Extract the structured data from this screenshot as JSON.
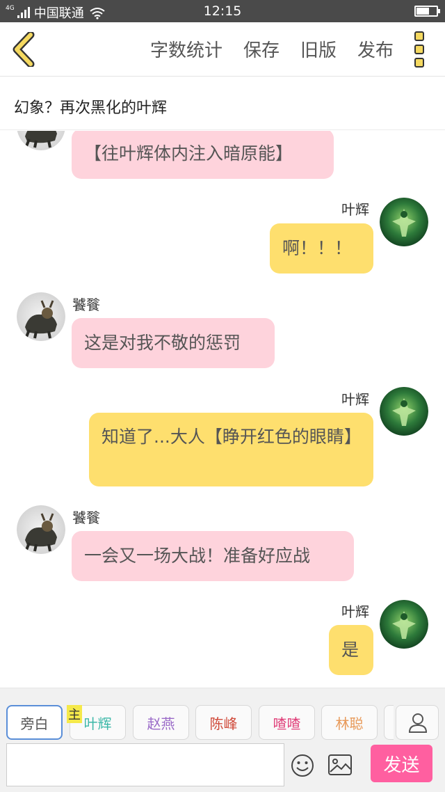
{
  "status_bar": {
    "network_type": "4G",
    "carrier": "中国联通",
    "time": "12:15"
  },
  "header": {
    "actions": [
      "字数统计",
      "保存",
      "旧版",
      "发布"
    ]
  },
  "story": {
    "title": "幻象？再次黑化的叶辉"
  },
  "messages": [
    {
      "side": "left",
      "speaker": "",
      "text": "【往叶辉体内注入暗原能】",
      "avatar": "beast-avatar"
    },
    {
      "side": "right",
      "speaker": "叶辉",
      "text": "啊！！！",
      "avatar": "green-hero-avatar"
    },
    {
      "side": "left",
      "speaker": "饕餮",
      "text": "这是对我不敬的惩罚",
      "avatar": "beast-avatar"
    },
    {
      "side": "right",
      "speaker": "叶辉",
      "text": "知道了...大人【睁开红色的眼睛】",
      "avatar": "green-hero-avatar"
    },
    {
      "side": "left",
      "speaker": "饕餮",
      "text": "一会又一场大战！准备好应战",
      "avatar": "beast-avatar"
    },
    {
      "side": "right",
      "speaker": "叶辉",
      "text": "是",
      "avatar": "green-hero-avatar"
    }
  ],
  "characters": {
    "narrator": "旁白",
    "main_tag": "主",
    "list": [
      {
        "name": "叶辉",
        "color": "#3cb8a8"
      },
      {
        "name": "赵燕",
        "color": "#9a6ac8"
      },
      {
        "name": "陈峰",
        "color": "#d04a3a"
      },
      {
        "name": "喳喳",
        "color": "#e0407a"
      },
      {
        "name": "林聪",
        "color": "#e89a5a"
      }
    ]
  },
  "composer": {
    "input_value": "",
    "send_label": "发送"
  },
  "colors": {
    "pink_bubble": "#fed3dc",
    "yellow_bubble": "#fedf6e",
    "send_button": "#ff5fa0",
    "status_bar": "#4a4a4a"
  }
}
